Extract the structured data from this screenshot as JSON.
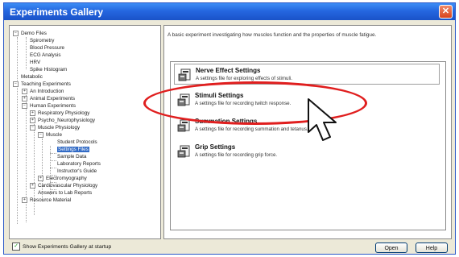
{
  "window": {
    "title": "Experiments Gallery",
    "close_glyph": "✕"
  },
  "tree": {
    "items": [
      {
        "label": "Demo Files",
        "expander": "−"
      },
      {
        "label": "Spirometry"
      },
      {
        "label": "Blood Pressure"
      },
      {
        "label": "ECG Analysis"
      },
      {
        "label": "HRV"
      },
      {
        "label": "Spike Histogram"
      },
      {
        "label": "Metabolic"
      },
      {
        "label": "Teaching Experiments",
        "expander": "−"
      },
      {
        "label": "An Introduction",
        "expander": "+"
      },
      {
        "label": "Animal Experiments",
        "expander": "+"
      },
      {
        "label": "Human Experiments",
        "expander": "−"
      },
      {
        "label": "Respiratory Physiology",
        "expander": "+"
      },
      {
        "label": "Psycho_Neurophysiology",
        "expander": "+"
      },
      {
        "label": "Muscle Physiology",
        "expander": "−"
      },
      {
        "label": "Muscle",
        "expander": "−"
      },
      {
        "label": "Student Protocols"
      },
      {
        "label": "Settings Files"
      },
      {
        "label": "Sample Data"
      },
      {
        "label": "Laboratory Reports"
      },
      {
        "label": "Instructor's Guide"
      },
      {
        "label": "Electromyography",
        "expander": "+"
      },
      {
        "label": "Cardiovascular Physiology",
        "expander": "+"
      },
      {
        "label": "Answers to Lab Reports"
      },
      {
        "label": "Resource Material",
        "expander": "+"
      }
    ],
    "selected": "Settings Files"
  },
  "description": "A basic experiment investigating how muscles function and the properties of muscle fatigue.",
  "settings_list": [
    {
      "title": "Nerve Effect Settings",
      "desc": "A settings file for exploring effects of stimuli."
    },
    {
      "title": "Stimuli Settings",
      "desc": "A settings file for recording twitch response."
    },
    {
      "title": "Summation Settings",
      "desc": "A settings file for recording summation and tetanus."
    },
    {
      "title": "Grip Settings",
      "desc": "A settings file for recording grip force."
    }
  ],
  "footer": {
    "show_at_startup_label": "Show Experiments Gallery at startup",
    "show_at_startup_checked": true,
    "check_glyph": "✓",
    "open_label": "Open",
    "help_label": "Help"
  },
  "colors": {
    "title_bar": "#2567e0",
    "highlight_oval": "#e01e1e",
    "selection": "#316ac5"
  }
}
